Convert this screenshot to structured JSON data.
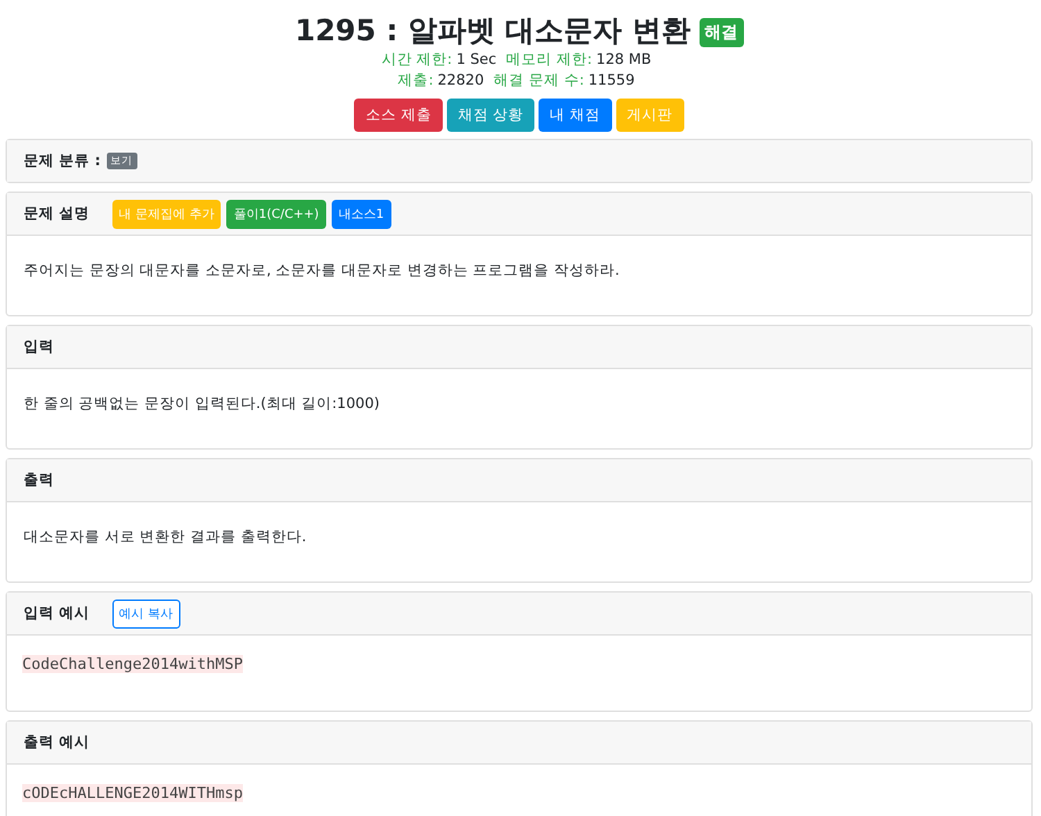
{
  "title": "1295 : 알파벳 대소문자 변환",
  "status_badge": "해결",
  "meta": [
    [
      {
        "label": "시간 제한:",
        "value": "1 Sec"
      },
      {
        "label": "메모리 제한:",
        "value": "128 MB"
      }
    ],
    [
      {
        "label": "제출:",
        "value": "22820"
      },
      {
        "label": "해결 문제 수:",
        "value": "11559"
      }
    ]
  ],
  "actions": [
    {
      "label": "소스 제출",
      "color": "#dc3545"
    },
    {
      "label": "채점 상황",
      "color": "#17a2b8"
    },
    {
      "label": "내 채점",
      "color": "#007bff"
    },
    {
      "label": "게시판",
      "color": "#ffc107"
    }
  ],
  "sections": [
    {
      "title": "문제 분류 :",
      "kind": "tag",
      "tag": "보기"
    },
    {
      "title": "문제 설명",
      "kind": "text",
      "buttons": [
        {
          "label": "내 문제집에 추가",
          "color": "#ffc107"
        },
        {
          "label": "풀이1(C/C++)",
          "color": "#28a745"
        },
        {
          "label": "내소스1",
          "color": "#007bff"
        }
      ],
      "body": "주어지는 문장의 대문자를 소문자로, 소문자를 대문자로 변경하는 프로그램을 작성하라."
    },
    {
      "title": "입력",
      "kind": "text",
      "body": "한 줄의 공백없는 문장이 입력된다.(최대 길이:1000)"
    },
    {
      "title": "출력",
      "kind": "text",
      "body": "대소문자를 서로 변환한 결과를 출력한다."
    },
    {
      "title": "입력 예시",
      "kind": "code",
      "copy_button": "예시 복사",
      "body": "CodeChallenge2014withMSP"
    },
    {
      "title": "출력 예시",
      "kind": "code",
      "body": "cODEcHALLENGE2014WITHmsp"
    }
  ]
}
